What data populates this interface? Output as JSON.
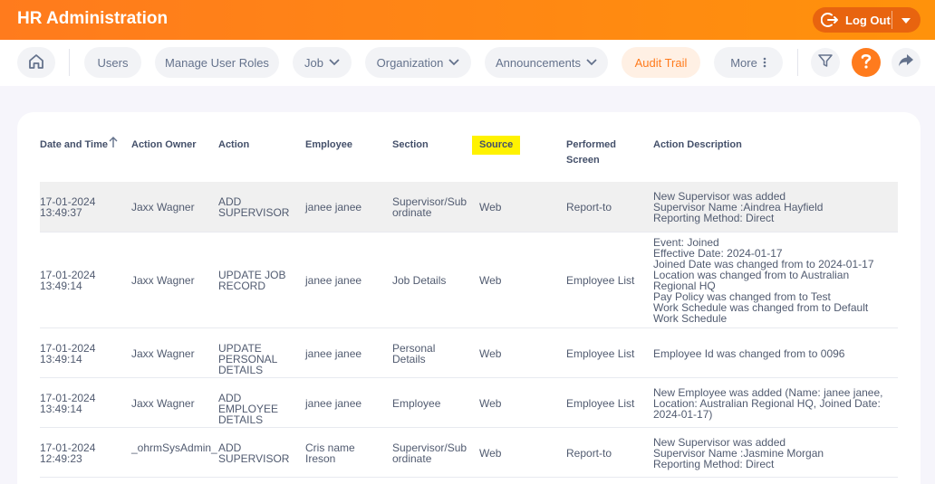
{
  "app": {
    "title": "HR Administration",
    "logout_label": "Log Out"
  },
  "nav": {
    "users": "Users",
    "roles": "Manage User Roles",
    "job": "Job",
    "organization": "Organization",
    "announcements": "Announcements",
    "audit": "Audit Trail",
    "more": "More"
  },
  "table": {
    "headers": {
      "datetime": "Date and Time",
      "owner": "Action Owner",
      "action": "Action",
      "employee": "Employee",
      "section": "Section",
      "source": "Source",
      "screen": "Performed Screen",
      "description": "Action Description"
    },
    "rows": [
      {
        "datetime": "17-01-2024 13:49:37",
        "owner": "Jaxx Wagner",
        "action": "ADD SUPERVISOR",
        "employee": "janee janee",
        "section": "Supervisor/Sub ordinate",
        "source": "Web",
        "screen": "Report-to",
        "description": [
          "New Supervisor was added",
          "Supervisor Name :Aindrea Hayfield",
          "Reporting Method: Direct"
        ]
      },
      {
        "datetime": "17-01-2024 13:49:14",
        "owner": "Jaxx Wagner",
        "action": "UPDATE JOB RECORD",
        "employee": "janee janee",
        "section": "Job Details",
        "source": "Web",
        "screen": "Employee List",
        "description": [
          "Event: Joined",
          "Effective Date: 2024-01-17",
          "Joined Date was changed from to 2024-01-17",
          "Location was changed from to Australian",
          "Regional HQ",
          "Pay Policy was changed from to Test",
          "Work Schedule was changed from to Default",
          "Work Schedule"
        ]
      },
      {
        "datetime": "17-01-2024 13:49:14",
        "owner": "Jaxx Wagner",
        "action": "UPDATE PERSONAL DETAILS",
        "employee": "janee janee",
        "section": "Personal Details",
        "source": "Web",
        "screen": "Employee List",
        "description": [
          "Employee Id was changed from to 0096"
        ]
      },
      {
        "datetime": "17-01-2024 13:49:14",
        "owner": "Jaxx Wagner",
        "action": "ADD EMPLOYEE DETAILS",
        "employee": "janee janee",
        "section": "Employee",
        "source": "Web",
        "screen": "Employee List",
        "description": [
          "New Employee was added (Name: janee janee,",
          "Location: Australian Regional HQ, Joined Date:",
          "2024-01-17)"
        ]
      },
      {
        "datetime": "17-01-2024 12:49:23",
        "owner": "_ohrmSysAdmin_",
        "action": "ADD SUPERVISOR",
        "employee": "Cris name Ireson",
        "section": "Supervisor/Sub ordinate",
        "source": "Web",
        "screen": "Report-to",
        "description": [
          "New Supervisor was added",
          "Supervisor Name :Jasmine Morgan",
          "Reporting Method: Direct"
        ]
      }
    ]
  },
  "colors": {
    "brand": "#ff7b1d",
    "highlight": "#fff200"
  }
}
